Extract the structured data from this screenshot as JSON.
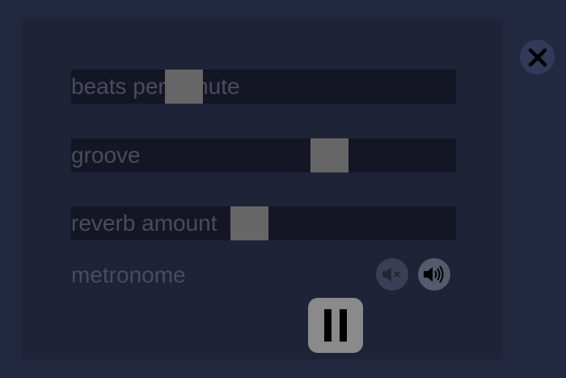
{
  "sliders": [
    {
      "id": "bpm",
      "label": "beats per minute",
      "value": 0.27
    },
    {
      "id": "groove",
      "label": "groove",
      "value": 0.69
    },
    {
      "id": "reverb",
      "label": "reverb amount",
      "value": 0.46
    }
  ],
  "metronome": {
    "label": "metronome",
    "mute_icon": "speaker-mute-icon",
    "sound_icon": "speaker-on-icon"
  },
  "controls": {
    "close_icon": "close-icon",
    "pause_icon": "pause-icon"
  },
  "colors": {
    "background": "#232841",
    "panel": "#1f2338",
    "slider_track": "#141626",
    "slider_thumb": "#666666",
    "label_text": "#494c5e"
  }
}
